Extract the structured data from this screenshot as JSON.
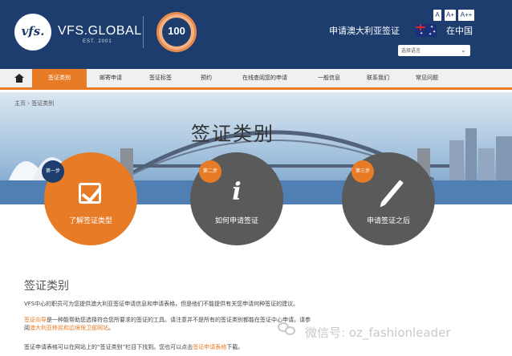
{
  "header": {
    "logo_text": "vfs.",
    "brand": "VFS.GLOBAL",
    "est": "EST. 2001",
    "badge_number": "100",
    "title": "申请澳大利亚签证",
    "location": "在中国",
    "font_sizes": [
      "A",
      "A+",
      "A++"
    ],
    "language_select_placeholder": "选择语言"
  },
  "nav": {
    "items": [
      {
        "label": "签证类别",
        "active": true
      },
      {
        "label": "邮寄申请"
      },
      {
        "label": "签证标签"
      },
      {
        "label": "预约"
      },
      {
        "label": "在线查阅您的申请"
      },
      {
        "label": "一般信息"
      },
      {
        "label": "联系我们"
      },
      {
        "label": "常见问题"
      }
    ]
  },
  "hero": {
    "breadcrumb": "主页 › 签证类别",
    "title": "签证类别"
  },
  "steps": [
    {
      "badge": "第一步",
      "label": "了解签证类型",
      "icon": "checkbox-icon"
    },
    {
      "badge": "第二步",
      "label": "如何申请签证",
      "icon": "info-icon"
    },
    {
      "badge": "第三步",
      "label": "申请签证之后",
      "icon": "pen-icon"
    }
  ],
  "content": {
    "section_title": "签证类别",
    "p1": "VFS中心的职员可为您提供澳大利亚签证申请信息和申请表格，但是他们不能提供有关您申请何种签证的建议。",
    "p2_link": "签证向导",
    "p2_rest": "是一种能帮助您选择符合您所要求的签证的工具。请注意并不是所有的签证类别都能在签证中心申请。请参",
    "p3_prefix": "阅",
    "p3_link": "澳大利亚移民和边境保卫部网站",
    "p3_suffix": "。",
    "p4_text": "签证申请表格可以在网站上的“签证类别”栏目下找到。您也可以点击",
    "p4_link": "签证申请表格",
    "p4_suffix": "下载。"
  },
  "watermark": "微信号: oz_fashionleader",
  "colors": {
    "header_bg": "#1c3d6e",
    "accent": "#e77b26",
    "circle_gray": "#5a5a5a"
  }
}
